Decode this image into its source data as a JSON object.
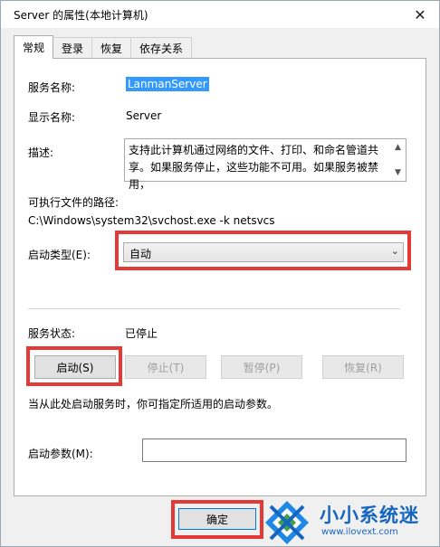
{
  "window": {
    "title": "Server 的属性(本地计算机)"
  },
  "tabs": [
    {
      "label": "常规",
      "active": true
    },
    {
      "label": "登录",
      "active": false
    },
    {
      "label": "恢复",
      "active": false
    },
    {
      "label": "依存关系",
      "active": false
    }
  ],
  "general": {
    "service_name_label": "服务名称:",
    "service_name_value": "LanmanServer",
    "display_name_label": "显示名称:",
    "display_name_value": "Server",
    "description_label": "描述:",
    "description_value": "支持此计算机通过网络的文件、打印、和命名管道共享。如果服务停止，这些功能不可用。如果服务被禁用，",
    "path_label": "可执行文件的路径:",
    "path_value": "C:\\Windows\\system32\\svchost.exe -k netsvcs",
    "startup_type_label": "启动类型(E):",
    "startup_type_value": "自动",
    "status_label": "服务状态:",
    "status_value": "已停止",
    "buttons": {
      "start": "启动(S)",
      "stop": "停止(T)",
      "pause": "暂停(P)",
      "resume": "恢复(R)"
    },
    "hint": "当从此处启动服务时，你可指定所适用的启动参数。",
    "start_params_label": "启动参数(M):",
    "start_params_value": ""
  },
  "footer": {
    "ok_label": "确定"
  },
  "watermark": {
    "title": "小小系统迷",
    "url": "www.ilovext.com"
  },
  "colors": {
    "highlight_border": "#e53935",
    "selection": "#3399ff",
    "watermark": "#1565c0"
  }
}
